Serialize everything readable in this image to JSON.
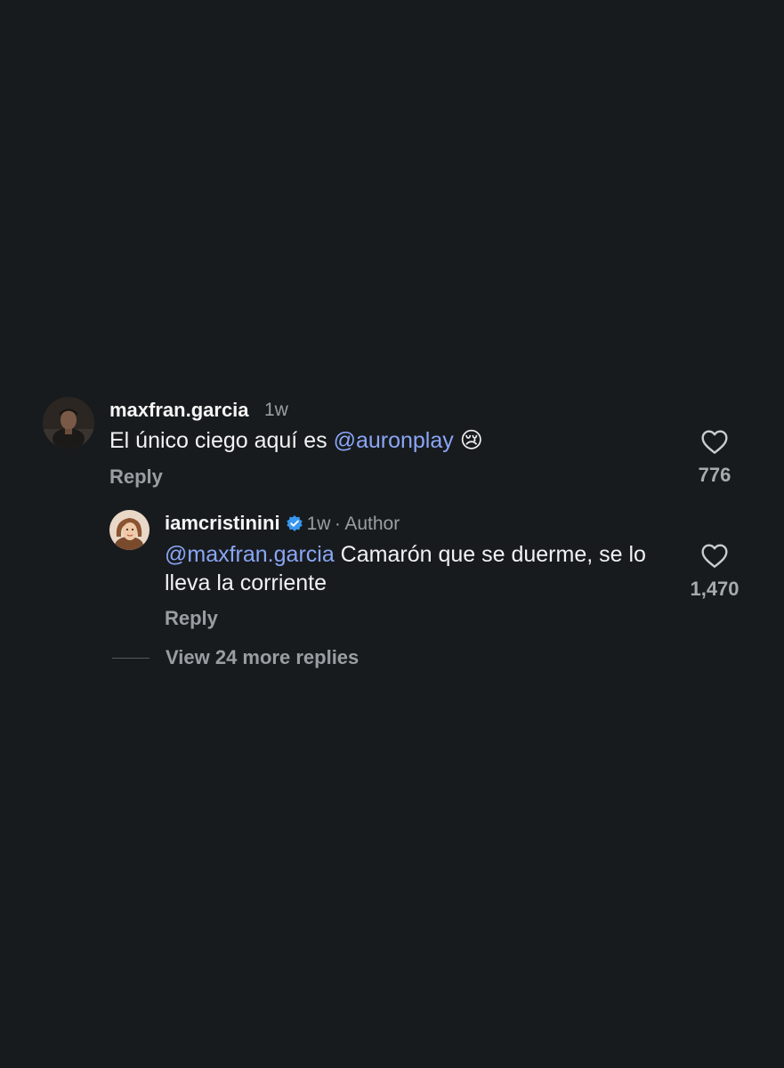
{
  "comment": {
    "username": "maxfran.garcia",
    "time": "1w",
    "text_before_mention": "El único ciego aquí es ",
    "mention": "@auronplay",
    "emoji": "😢",
    "reply_label": "Reply",
    "like_count": "776"
  },
  "reply": {
    "username": "iamcristinini",
    "time": "1w",
    "separator": "·",
    "author_label": "Author",
    "mention": "@maxfran.garcia",
    "text_after_mention": " Camarón que se duerme, se lo lleva la corriente",
    "reply_label": "Reply",
    "like_count": "1,470"
  },
  "view_more_label": "View 24 more replies",
  "colors": {
    "background": "#181b1e",
    "mention": "#8aa6f6",
    "verified": "#3897f0",
    "muted": "#9a9ea3"
  },
  "icons": {
    "like": "heart-outline-icon",
    "verified": "verified-badge-icon"
  }
}
